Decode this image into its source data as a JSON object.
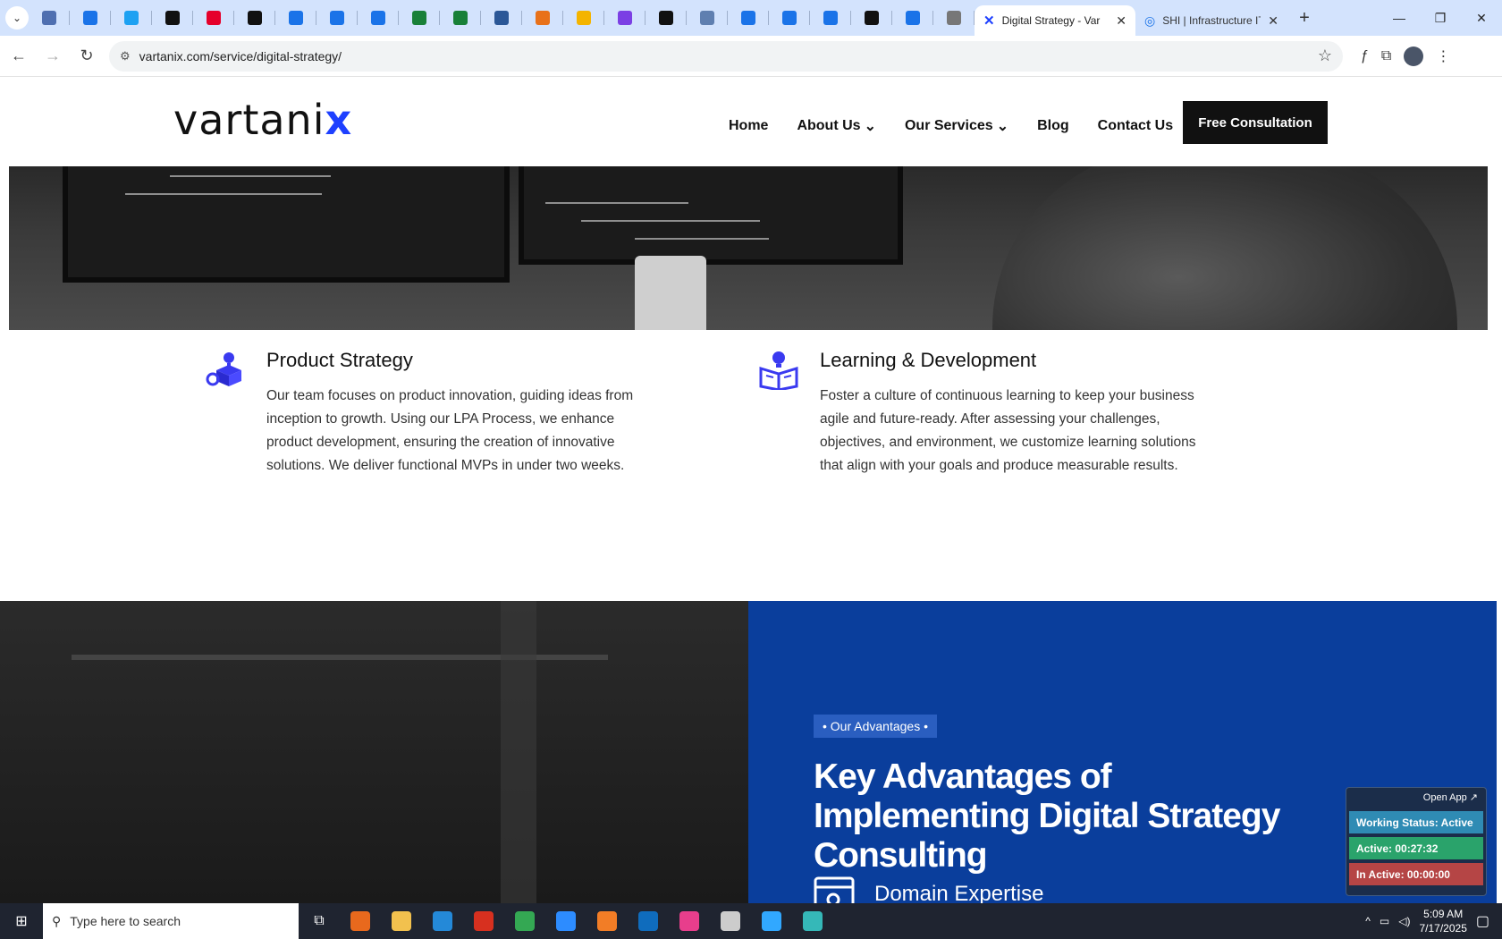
{
  "browser": {
    "active_tab_title": "Digital Strategy - Var",
    "second_tab_title": "SHI | Infrastructure IT",
    "url": "vartanix.com/service/digital-strategy/",
    "mini_tab_colors": [
      "#4f6fb0",
      "#1a73e8",
      "#1da1f2",
      "#111111",
      "#e5002b",
      "#111111",
      "#1a73e8",
      "#1a73e8",
      "#1a73e8",
      "#188038",
      "#188038",
      "#2b5797",
      "#e8711a",
      "#f4b400",
      "#7b3fe4",
      "#111111",
      "#5f7fb0",
      "#1a73e8",
      "#1a73e8",
      "#1a73e8",
      "#111111",
      "#1a73e8",
      "#777777"
    ]
  },
  "header": {
    "logo_text": "vartani",
    "logo_accent": "x",
    "nav": {
      "home": "Home",
      "about": "About Us",
      "services": "Our Services",
      "blog": "Blog",
      "contact": "Contact Us"
    },
    "cta": "Free Consultation"
  },
  "services": [
    {
      "title": "Product Strategy",
      "description": "Our team focuses on product innovation, guiding ideas from inception to growth. Using our LPA Process, we enhance product development, ensuring the creation of innovative solutions. We deliver functional MVPs in under two weeks."
    },
    {
      "title": "Learning & Development",
      "description": "Foster a culture of continuous learning to keep your business agile and future-ready. After assessing your challenges, objectives, and environment, we customize learning solutions that align with your goals and produce measurable results."
    }
  ],
  "advantages": {
    "chip": "• Our Advantages •",
    "title": "Key Advantages of Implementing Digital Strategy Consulting",
    "first_item": "Domain Expertise"
  },
  "widget": {
    "open_app": "Open App ↗",
    "working_status": "Working Status: Active",
    "active": "Active: 00:27:32",
    "inactive": "In Active: 00:00:00"
  },
  "taskbar": {
    "search_placeholder": "Type here to search",
    "time": "5:09 AM",
    "date": "7/17/2025",
    "app_colors": [
      "#e8691d",
      "#f2c14e",
      "#2489d8",
      "#d7301f",
      "#34a853",
      "#2d8cff",
      "#f27d26",
      "#0f6cbd",
      "#e83e8c",
      "#cccccc",
      "#31a8ff",
      "#35b8b8"
    ]
  },
  "colors": {
    "brand_blue": "#1e40ff",
    "section_blue": "#0a3e9c"
  }
}
